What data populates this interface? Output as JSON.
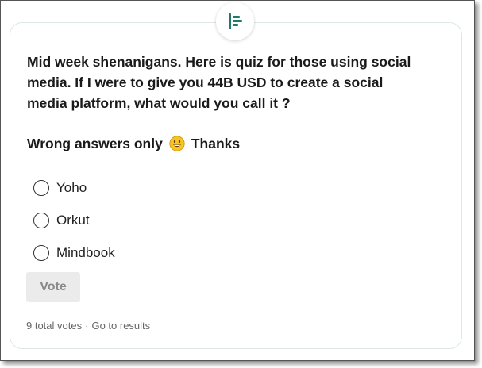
{
  "poll": {
    "icon": "poll-icon",
    "accent_color": "#1e7a6b",
    "question": "Mid week shenanigans. Here is quiz for those using social\nmedia. If I were to give you 44B USD to create a social\nmedia platform, what would you call it ?",
    "note_before": "Wrong answers only",
    "note_emoji": "grinning-face-icon",
    "note_after": "Thanks",
    "options": [
      {
        "label": "Yoho"
      },
      {
        "label": "Orkut"
      },
      {
        "label": "Mindbook"
      }
    ],
    "vote_label": "Vote",
    "total_votes": "9 total votes",
    "separator": "·",
    "results_link": "Go to results"
  }
}
